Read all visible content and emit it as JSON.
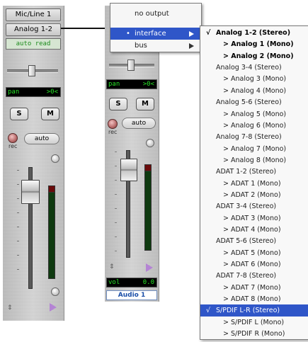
{
  "strip1": {
    "input_label": "Mic/Line 1",
    "output_label": "Analog 1-2",
    "automation_label": "auto read",
    "pan_label": "pan",
    "pan_value": ">0<",
    "solo_label": "S",
    "mute_label": "M",
    "rec_label": "rec",
    "auto_label": "auto"
  },
  "strip2": {
    "pan_label": "pan",
    "pan_value": ">0<",
    "solo_label": "S",
    "mute_label": "M",
    "rec_label": "rec",
    "auto_label": "auto",
    "vol_label": "vol",
    "vol_value": "0.0",
    "track_name": "Audio 1"
  },
  "output_menu": {
    "items": [
      {
        "label": "no output",
        "bullet": "",
        "has_submenu": false,
        "selected": false
      },
      {
        "label": "interface",
        "bullet": "•",
        "has_submenu": true,
        "selected": true
      },
      {
        "label": "bus",
        "bullet": "",
        "has_submenu": true,
        "selected": false
      }
    ]
  },
  "interface_submenu": {
    "items": [
      {
        "label": "Analog 1-2 (Stereo)",
        "check": "√",
        "bold": true,
        "child": false,
        "selected": false
      },
      {
        "label": "> Analog 1 (Mono)",
        "check": "",
        "bold": true,
        "child": true,
        "selected": false
      },
      {
        "label": "> Analog 2 (Mono)",
        "check": "",
        "bold": true,
        "child": true,
        "selected": false
      },
      {
        "label": "Analog 3-4 (Stereo)",
        "check": "",
        "bold": false,
        "child": false,
        "selected": false
      },
      {
        "label": "> Analog 3 (Mono)",
        "check": "",
        "bold": false,
        "child": true,
        "selected": false
      },
      {
        "label": "> Analog 4 (Mono)",
        "check": "",
        "bold": false,
        "child": true,
        "selected": false
      },
      {
        "label": "Analog 5-6 (Stereo)",
        "check": "",
        "bold": false,
        "child": false,
        "selected": false
      },
      {
        "label": "> Analog 5 (Mono)",
        "check": "",
        "bold": false,
        "child": true,
        "selected": false
      },
      {
        "label": "> Analog 6 (Mono)",
        "check": "",
        "bold": false,
        "child": true,
        "selected": false
      },
      {
        "label": "Analog 7-8 (Stereo)",
        "check": "",
        "bold": false,
        "child": false,
        "selected": false
      },
      {
        "label": "> Analog 7 (Mono)",
        "check": "",
        "bold": false,
        "child": true,
        "selected": false
      },
      {
        "label": "> Analog 8 (Mono)",
        "check": "",
        "bold": false,
        "child": true,
        "selected": false
      },
      {
        "label": "ADAT 1-2 (Stereo)",
        "check": "",
        "bold": false,
        "child": false,
        "selected": false
      },
      {
        "label": "> ADAT 1 (Mono)",
        "check": "",
        "bold": false,
        "child": true,
        "selected": false
      },
      {
        "label": "> ADAT 2 (Mono)",
        "check": "",
        "bold": false,
        "child": true,
        "selected": false
      },
      {
        "label": "ADAT 3-4 (Stereo)",
        "check": "",
        "bold": false,
        "child": false,
        "selected": false
      },
      {
        "label": "> ADAT 3 (Mono)",
        "check": "",
        "bold": false,
        "child": true,
        "selected": false
      },
      {
        "label": "> ADAT 4 (Mono)",
        "check": "",
        "bold": false,
        "child": true,
        "selected": false
      },
      {
        "label": "ADAT 5-6 (Stereo)",
        "check": "",
        "bold": false,
        "child": false,
        "selected": false
      },
      {
        "label": "> ADAT 5 (Mono)",
        "check": "",
        "bold": false,
        "child": true,
        "selected": false
      },
      {
        "label": "> ADAT 6 (Mono)",
        "check": "",
        "bold": false,
        "child": true,
        "selected": false
      },
      {
        "label": "ADAT 7-8 (Stereo)",
        "check": "",
        "bold": false,
        "child": false,
        "selected": false
      },
      {
        "label": "> ADAT 7 (Mono)",
        "check": "",
        "bold": false,
        "child": true,
        "selected": false
      },
      {
        "label": "> ADAT 8 (Mono)",
        "check": "",
        "bold": false,
        "child": true,
        "selected": false
      },
      {
        "label": "S/PDIF L-R (Stereo)",
        "check": "√",
        "bold": false,
        "child": false,
        "selected": true
      },
      {
        "label": "> S/PDIF L (Mono)",
        "check": "",
        "bold": false,
        "child": true,
        "selected": false
      },
      {
        "label": "> S/PDIF R (Mono)",
        "check": "",
        "bold": false,
        "child": true,
        "selected": false
      }
    ]
  },
  "colors": {
    "menu_highlight": "#2f56c8",
    "lcd_text": "#27e327",
    "automation_text": "#1c8a1c",
    "track_name_text": "#1a4ea8"
  }
}
